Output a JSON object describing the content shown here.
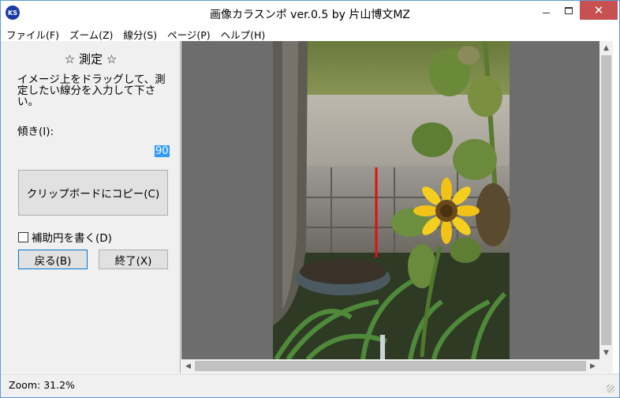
{
  "window": {
    "title": "画像カラスンポ ver.0.5 by 片山博文MZ",
    "icon_text": "KS",
    "minimize_icon": "minimize-icon",
    "maximize_icon": "maximize-icon",
    "close_icon": "close-icon",
    "close_glyph": "✕"
  },
  "menu": {
    "items": [
      "ファイル(F)",
      "ズーム(Z)",
      "線分(S)",
      "ページ(P)",
      "ヘルプ(H)"
    ]
  },
  "panel": {
    "title": "☆ 測定 ☆",
    "instructions": "イメージ上をドラッグして、測定したい線分を入力して下さい。",
    "slope_label": "傾き(I):",
    "slope_value": "90",
    "copy_button": "クリップボードにコピー(C)",
    "aux_circle_label": "補助円を書く(D)",
    "aux_circle_checked": false,
    "back_button": "戻る(B)",
    "exit_button": "終了(X)"
  },
  "status": {
    "zoom_text": "Zoom: 31.2%"
  },
  "colors": {
    "measure_line": "#e01010",
    "close_button": "#c75050",
    "selection": "#3399ff"
  }
}
